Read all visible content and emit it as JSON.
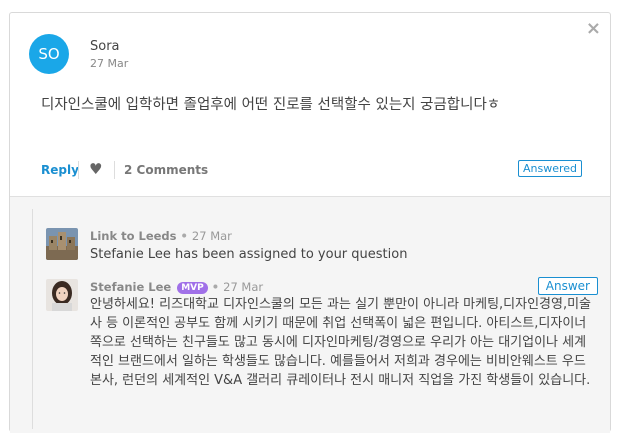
{
  "question": {
    "author": "Sora",
    "avatar_initials": "SO",
    "date": "27 Mar",
    "text": "디자인스쿨에 입학하면 졸업후에 어떤 진로를 선택할수 있는지 궁금합니다ㅎ",
    "reply_label": "Reply",
    "comments_label": "2 Comments",
    "status_badge": "Answered",
    "close_glyph": "×",
    "heart_glyph": "♥"
  },
  "activity": {
    "author": "Link to Leeds",
    "date": "27 Mar",
    "text": "Stefanie Lee has been assigned to your question"
  },
  "answer": {
    "author": "Stefanie Lee",
    "badge": "MVP",
    "date": "27 Mar",
    "answer_label": "Answer",
    "text": "안녕하세요! 리즈대학교 디자인스쿨의 모든 과는 실기 뿐만이 아니라 마케팅,디자인경영,미술사 등 이론적인 공부도 함께 시키기 때문에 취업 선택폭이 넓은 편입니다. 아티스트,디자이너쪽으로 선택하는 친구들도 많고 동시에 디자인마케팅/경영으로 우리가 아는 대기업이나 세계적인 브랜드에서 일하는 학생들도 많습니다. 예를들어서 저희과 경우에는 비비안웨스트 우드 본사, 런던의 세계적인 V&A 갤러리 큐레이터나 전시 매니저 직업을 가진 학생들이 있습니다."
  },
  "separator_dot": "•",
  "colors": {
    "accent": "#1a8fd1",
    "avatar_bg": "#1aa7e8",
    "mvp_badge": "#a070e8"
  }
}
